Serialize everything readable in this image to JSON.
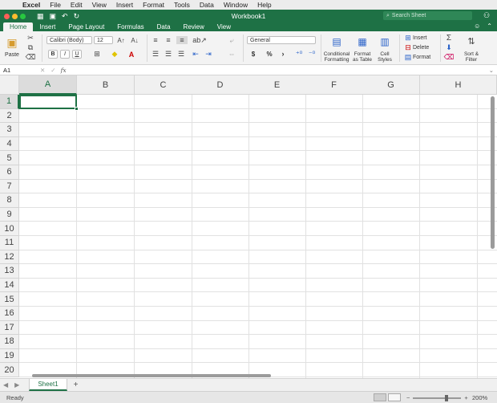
{
  "menubar": {
    "apple": "",
    "items": [
      "Excel",
      "File",
      "Edit",
      "View",
      "Insert",
      "Format",
      "Tools",
      "Data",
      "Window",
      "Help"
    ]
  },
  "titlebar": {
    "title": "Workbook1",
    "search_placeholder": "Search Sheet"
  },
  "tabs": [
    "Home",
    "Insert",
    "Page Layout",
    "Formulas",
    "Data",
    "Review",
    "View"
  ],
  "ribbon": {
    "paste_label": "Paste",
    "font_name": "Calibri (Body)",
    "font_size": "12",
    "bold": "B",
    "italic": "I",
    "underline": "U",
    "number_format": "General",
    "currency": "$",
    "percent": "%",
    "comma": "›",
    "conditional_formatting": "Conditional Formatting",
    "format_as_table": "Format as Table",
    "cell_styles": "Cell Styles",
    "insert": "Insert",
    "delete": "Delete",
    "format": "Format",
    "sort_filter": "Sort & Filter"
  },
  "formula_bar": {
    "name_box": "A1",
    "fx": "fx",
    "formula": ""
  },
  "grid": {
    "columns": [
      "A",
      "B",
      "C",
      "D",
      "E",
      "F",
      "G",
      "H"
    ],
    "rows": [
      "1",
      "2",
      "3",
      "4",
      "5",
      "6",
      "7",
      "8",
      "9",
      "10",
      "11",
      "12",
      "13",
      "14",
      "15",
      "16",
      "17",
      "18",
      "19",
      "20"
    ],
    "selected_cell": "A1"
  },
  "sheets": {
    "tabs": [
      "Sheet1"
    ],
    "add_label": "+"
  },
  "statusbar": {
    "status": "Ready",
    "zoom": "200%"
  },
  "colors": {
    "accent": "#1e7145"
  }
}
